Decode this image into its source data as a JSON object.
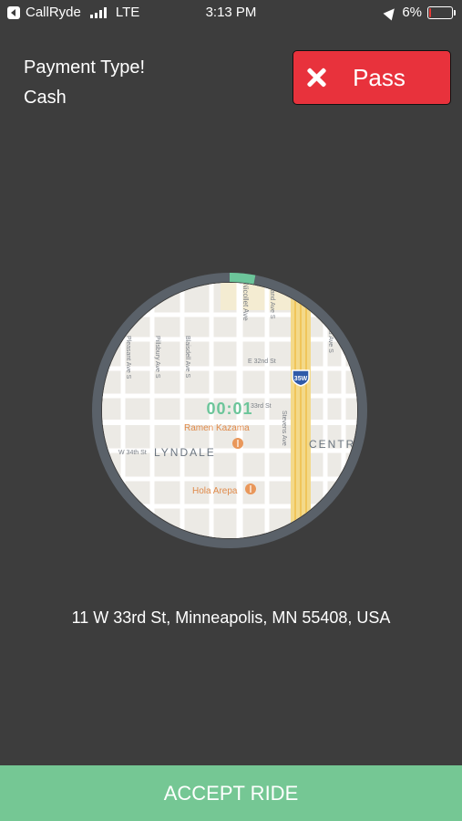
{
  "status_bar": {
    "carrier": "CallRyde",
    "network": "LTE",
    "time": "3:13 PM",
    "battery": "6%",
    "battery_level": 0.06
  },
  "payment": {
    "label": "Payment Type!",
    "value": "Cash"
  },
  "pass_button": {
    "label": "Pass"
  },
  "map": {
    "labels": {
      "nicollet": "Nicollet Ave",
      "e32nd": "E 32nd St",
      "w34th": "W 34th St",
      "e33rd": "33rd St",
      "lyndale": "LYNDALE",
      "centr": "CENTR",
      "ramen": "Ramen Kazama",
      "hola": "Hola Arepa",
      "pleasant": "Pleasant Ave S",
      "pillsbury": "Pillsbury Ave S",
      "blaisdell": "Blaisdell Ave S",
      "grand": "Grand Ave S",
      "second": "2nd Ave S",
      "stevens": "Stevens Ave",
      "highway": "35W"
    }
  },
  "timer": {
    "value": "00:01",
    "progress": 0.03
  },
  "address": "11 W 33rd St, Minneapolis, MN 55408, USA",
  "accept_button": {
    "label": "ACCEPT RIDE"
  },
  "colors": {
    "background": "#3d3d3d",
    "pass_red": "#e8323c",
    "accept_green": "#75c794",
    "timer_green": "#6cc59a",
    "ring_gray": "#5a6169"
  }
}
